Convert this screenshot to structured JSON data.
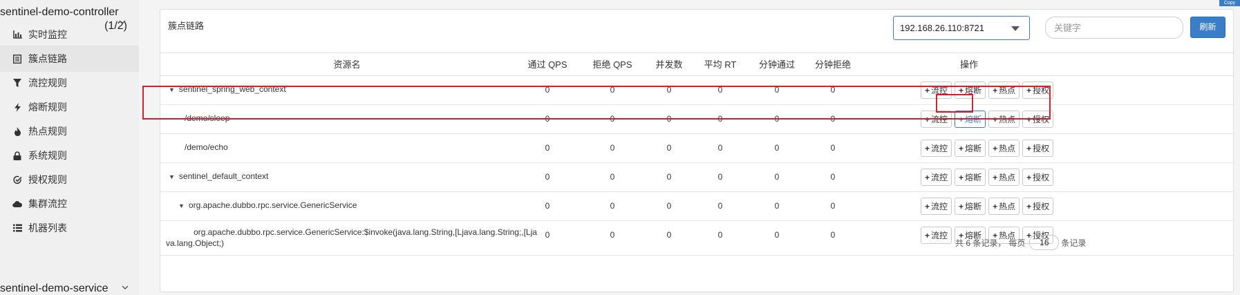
{
  "sidebar": {
    "app_name": "sentinel-demo-controller",
    "app_count": "(1/2)",
    "items": [
      {
        "label": "实时监控",
        "icon": "bar-chart-icon"
      },
      {
        "label": "簇点链路",
        "icon": "list-icon"
      },
      {
        "label": "流控规则",
        "icon": "filter-icon"
      },
      {
        "label": "熔断规则",
        "icon": "bolt-icon"
      },
      {
        "label": "热点规则",
        "icon": "fire-icon"
      },
      {
        "label": "系统规则",
        "icon": "lock-icon"
      },
      {
        "label": "授权规则",
        "icon": "check-circle-icon"
      },
      {
        "label": "集群流控",
        "icon": "cloud-icon"
      },
      {
        "label": "机器列表",
        "icon": "list-bullets-icon"
      }
    ],
    "app2_name": "sentinel-demo-service"
  },
  "panel": {
    "title": "簇点链路",
    "machine_selected": "192.168.26.110:8721",
    "keyword_placeholder": "关键字",
    "refresh_label": "刷新",
    "copy_tag": "Copy"
  },
  "table": {
    "headers": [
      "资源名",
      "通过 QPS",
      "拒绝 QPS",
      "并发数",
      "平均 RT",
      "分钟通过",
      "分钟拒绝",
      "操作"
    ],
    "op_labels": [
      "流控",
      "熔断",
      "热点",
      "授权"
    ],
    "rows": [
      {
        "resource": "sentinel_spring_web_context",
        "pass_qps": "0",
        "block_qps": "0",
        "threads": "0",
        "rt": "0",
        "min_pass": "0",
        "min_block": "0"
      },
      {
        "resource": "/demo/sleep",
        "pass_qps": "0",
        "block_qps": "0",
        "threads": "0",
        "rt": "0",
        "min_pass": "0",
        "min_block": "0"
      },
      {
        "resource": "/demo/echo",
        "pass_qps": "0",
        "block_qps": "0",
        "threads": "0",
        "rt": "0",
        "min_pass": "0",
        "min_block": "0"
      },
      {
        "resource": "sentinel_default_context",
        "pass_qps": "0",
        "block_qps": "0",
        "threads": "0",
        "rt": "0",
        "min_pass": "0",
        "min_block": "0"
      },
      {
        "resource": "org.apache.dubbo.rpc.service.GenericService",
        "pass_qps": "0",
        "block_qps": "0",
        "threads": "0",
        "rt": "0",
        "min_pass": "0",
        "min_block": "0"
      },
      {
        "resource": "org.apache.dubbo.rpc.service.GenericService:$invoke(java.lang.String,[Ljava.lang.String;,[Ljava.lang.Object;)",
        "pass_qps": "0",
        "block_qps": "0",
        "threads": "0",
        "rt": "0",
        "min_pass": "0",
        "min_block": "0"
      }
    ]
  },
  "pager": {
    "total_text": "共 6 条记录，",
    "per_page_label": "每页",
    "page_size": "16",
    "records_suffix": "条记录"
  },
  "colors": {
    "accent": "#3a7dc8",
    "highlight": "#d0202c"
  }
}
